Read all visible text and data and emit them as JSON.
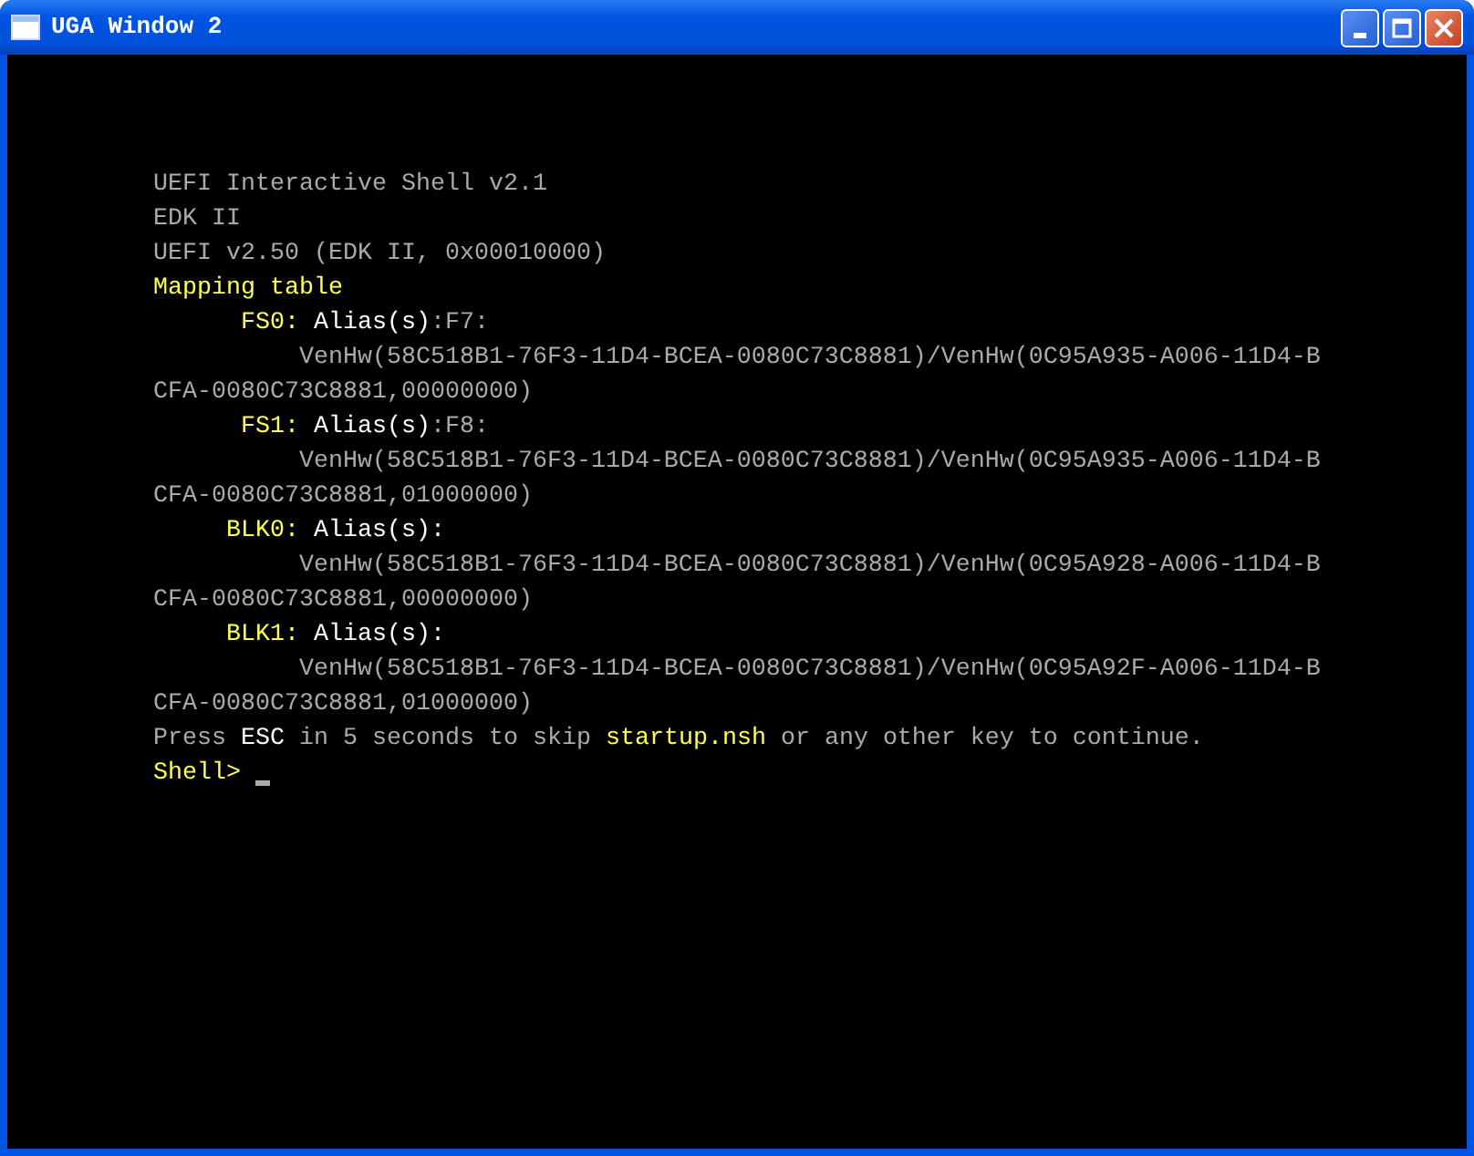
{
  "window": {
    "title": "UGA Window 2",
    "buttons": [
      {
        "kind": "minimize"
      },
      {
        "kind": "maximize"
      },
      {
        "kind": "close"
      }
    ]
  },
  "console": {
    "lines": [
      [
        {
          "text": "UEFI Interactive Shell v2.1",
          "color": "#aaaaaa"
        }
      ],
      [
        {
          "text": "EDK II",
          "color": "#aaaaaa"
        }
      ],
      [
        {
          "text": "UEFI v2.50 (EDK II, 0x00010000)",
          "color": "#aaaaaa"
        }
      ],
      [
        {
          "text": "Mapping table",
          "color": "#ffff55"
        }
      ],
      [
        {
          "text": "      FS0:",
          "color": "#ffff55"
        },
        {
          "text": " Alias(s)",
          "color": "#ffffff"
        },
        {
          "text": ":F7:",
          "color": "#aaaaaa"
        }
      ],
      [
        {
          "text": "          VenHw(58C518B1-76F3-11D4-BCEA-0080C73C8881)/VenHw(0C95A935-A006-11D4-B",
          "color": "#aaaaaa"
        }
      ],
      [
        {
          "text": "CFA-0080C73C8881,00000000)",
          "color": "#aaaaaa"
        }
      ],
      [
        {
          "text": "      FS1:",
          "color": "#ffff55"
        },
        {
          "text": " Alias(s)",
          "color": "#ffffff"
        },
        {
          "text": ":F8:",
          "color": "#aaaaaa"
        }
      ],
      [
        {
          "text": "          VenHw(58C518B1-76F3-11D4-BCEA-0080C73C8881)/VenHw(0C95A935-A006-11D4-B",
          "color": "#aaaaaa"
        }
      ],
      [
        {
          "text": "CFA-0080C73C8881,01000000)",
          "color": "#aaaaaa"
        }
      ],
      [
        {
          "text": "     BLK0:",
          "color": "#ffff55"
        },
        {
          "text": " Alias(s):",
          "color": "#ffffff"
        }
      ],
      [
        {
          "text": "          VenHw(58C518B1-76F3-11D4-BCEA-0080C73C8881)/VenHw(0C95A928-A006-11D4-B",
          "color": "#aaaaaa"
        }
      ],
      [
        {
          "text": "CFA-0080C73C8881,00000000)",
          "color": "#aaaaaa"
        }
      ],
      [
        {
          "text": "     BLK1:",
          "color": "#ffff55"
        },
        {
          "text": " Alias(s):",
          "color": "#ffffff"
        }
      ],
      [
        {
          "text": "          VenHw(58C518B1-76F3-11D4-BCEA-0080C73C8881)/VenHw(0C95A92F-A006-11D4-B",
          "color": "#aaaaaa"
        }
      ],
      [
        {
          "text": "CFA-0080C73C8881,01000000)",
          "color": "#aaaaaa"
        }
      ],
      [
        {
          "text": "Press ",
          "color": "#aaaaaa"
        },
        {
          "text": "ESC",
          "color": "#ffffff"
        },
        {
          "text": " in 5 seconds to skip ",
          "color": "#aaaaaa"
        },
        {
          "text": "startup.nsh",
          "color": "#ffff55"
        },
        {
          "text": " or any other key to continue.",
          "color": "#aaaaaa"
        }
      ],
      [
        {
          "text": "Shell> ",
          "color": "#ffff55"
        }
      ]
    ],
    "cursor": true
  }
}
